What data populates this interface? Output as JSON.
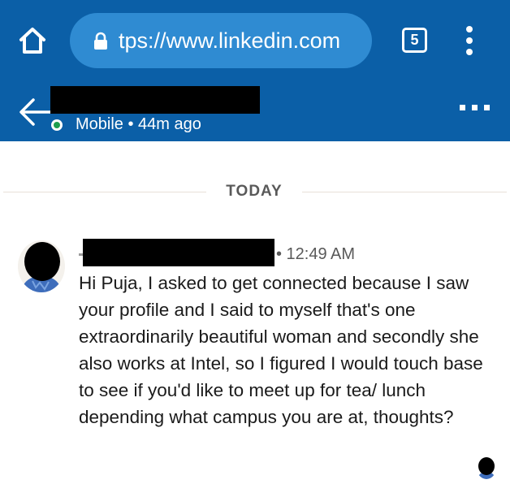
{
  "browser": {
    "url": "tps://www.linkedin.com",
    "tab_count": "5",
    "toolbar_color": "#0b5fa7",
    "url_pill_color": "#2f8bd2",
    "icons": [
      "home-icon",
      "lock-icon",
      "tab-switcher-icon",
      "overflow-menu-icon"
    ]
  },
  "conversation_header": {
    "status": "Mobile • 44m ago",
    "presence_color": "#1e9e4e",
    "icons": [
      "back-arrow-icon",
      "more-options-icon"
    ]
  },
  "divider": {
    "label": "TODAY"
  },
  "message": {
    "time": "• 12:49 AM",
    "text": "Hi Puja, I asked to get connected because I saw your profile and I said to myself that's one extraordinarily beautiful woman and secondly she also works at Intel, so I figured I would touch base to see if you'd like to meet up for tea/ lunch depending what campus you are at, thoughts?"
  }
}
